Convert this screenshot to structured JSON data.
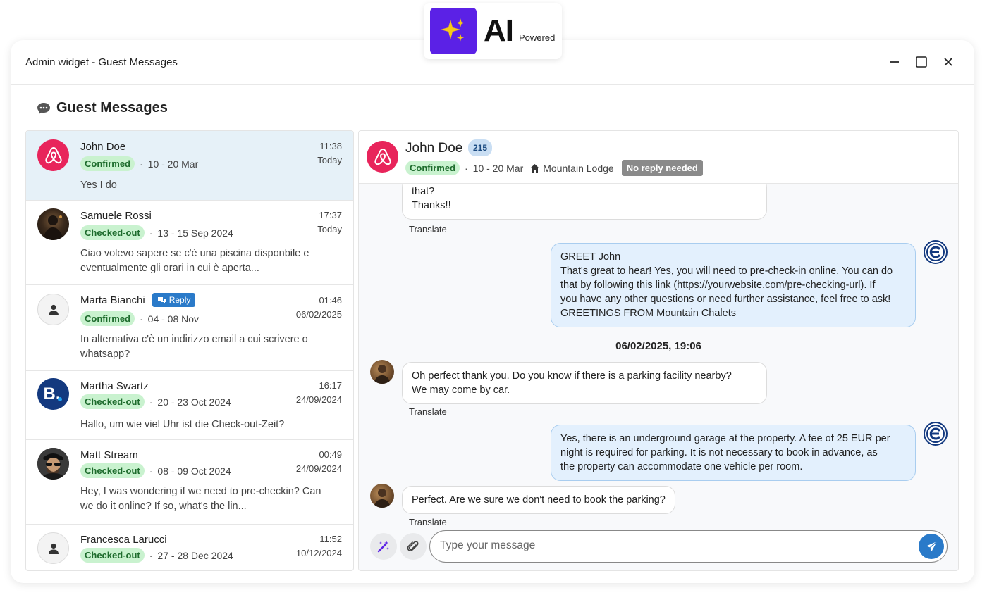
{
  "badge": {
    "title": "AI",
    "subtitle": "Powered"
  },
  "window": {
    "title": "Admin widget - Guest Messages"
  },
  "section": {
    "title": "Guest Messages"
  },
  "conversations": [
    {
      "name": "John Doe",
      "status": "Confirmed",
      "dates": "10 - 20 Mar",
      "time": "11:38",
      "day": "Today",
      "preview": "Yes I do",
      "source": "airbnb"
    },
    {
      "name": "Samuele Rossi",
      "status": "Checked-out",
      "dates": "13 - 15 Sep 2024",
      "time": "17:37",
      "day": "Today",
      "preview": "Ciao volevo sapere se c'è una piscina disponbile e eventualmente gli orari in cui è aperta...",
      "source": "photo"
    },
    {
      "name": "Marta Bianchi",
      "status": "Confirmed",
      "dates": "04 - 08 Nov",
      "time": "01:46",
      "day": "06/02/2025",
      "preview": "In alternativa c'è un indirizzo email a cui scrivere o whatsapp?",
      "reply_label": "Reply",
      "source": "user"
    },
    {
      "name": "Martha Swartz",
      "status": "Checked-out",
      "dates": "20 - 23 Oct 2024",
      "time": "16:17",
      "day": "24/09/2024",
      "preview": "Hallo, um wie viel Uhr ist die Check-out-Zeit?",
      "source": "booking",
      "logo_letter": "B."
    },
    {
      "name": "Matt Stream",
      "status": "Checked-out",
      "dates": "08 - 09 Oct 2024",
      "time": "00:49",
      "day": "24/09/2024",
      "preview": "Hey, I was wondering if we need to pre-checkin? Can we do it online? If so, what's the lin...",
      "source": "photo"
    },
    {
      "name": "Francesca Larucci",
      "status": "Checked-out",
      "dates": "27 - 28 Dec 2024",
      "time": "11:52",
      "day": "10/12/2024",
      "source": "user"
    }
  ],
  "chat": {
    "name": "John Doe",
    "count": "215",
    "status": "Confirmed",
    "dates": "10 - 20 Mar",
    "property": "Mountain Lodge",
    "no_reply": "No reply needed",
    "messages": {
      "m1": {
        "line1": "that?",
        "line2": "Thanks!!"
      },
      "m2": {
        "l1": "GREET John",
        "l2": "That's great to hear! Yes, you will need to pre-check-in online. You can do",
        "l3a": "that by following this link (",
        "link": "https://yourwebsite.com/pre-checking-url",
        "l3b": "). If",
        "l4": "you have any other questions or need further assistance, feel free to ask!",
        "l5": "GREETINGS FROM Mountain Chalets"
      },
      "date_sep": "06/02/2025, 19:06",
      "m3": {
        "line1": "Oh perfect thank you. Do you know if there is a parking facility nearby?",
        "line2": "We may come by car."
      },
      "m4": {
        "line1": "Yes, there is an underground garage at the property. A fee of 25 EUR per",
        "line2": "night is required for parking. It is not necessary to book in advance, as",
        "line3": "the property can accommodate one vehicle per room."
      },
      "m5": {
        "line1": "Perfect. Are we sure we don't need to book the parking?"
      }
    },
    "translate_label": "Translate",
    "input_placeholder": "Type your message"
  },
  "colors": {
    "accent": "#2a7ac9",
    "ai_purple": "#5b21e6",
    "airbnb": "#e8245b",
    "booking": "#13397f",
    "confirmed_bg": "#c9f2cf"
  }
}
